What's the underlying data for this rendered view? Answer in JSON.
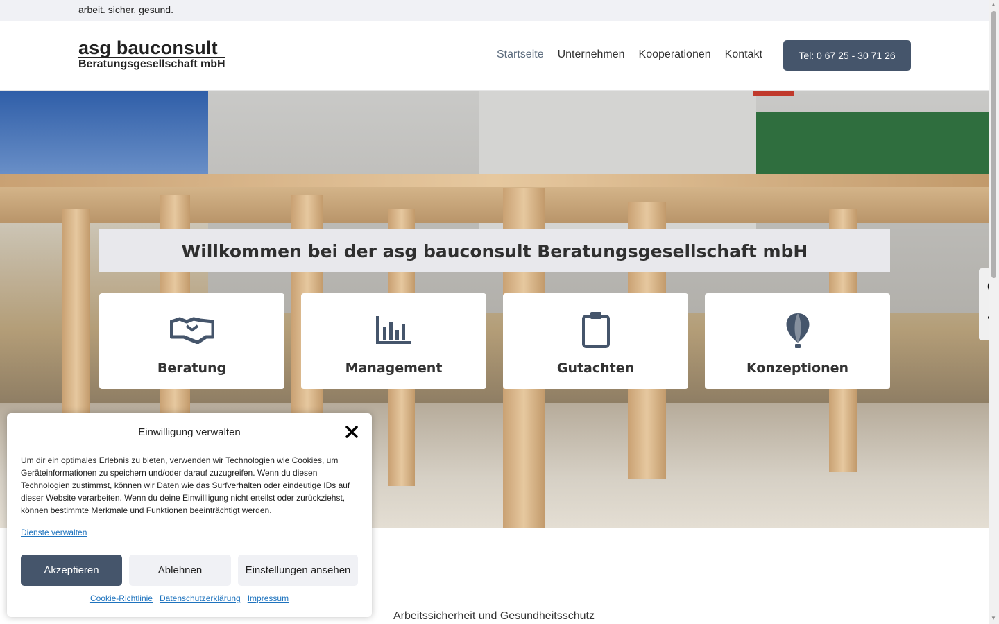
{
  "topbar": {
    "tagline": "arbeit. sicher. gesund."
  },
  "header": {
    "logo_line1": "asg bauconsult",
    "logo_line2": "Beratungsgesellschaft mbH",
    "nav": [
      {
        "label": "Startseite",
        "active": true
      },
      {
        "label": "Unternehmen"
      },
      {
        "label": "Kooperationen"
      },
      {
        "label": "Kontakt"
      }
    ],
    "call_button": "Tel: 0 67 25 - 30 71 26"
  },
  "hero": {
    "welcome": "Willkommen bei der asg bauconsult Beratungsgesellschaft mbH",
    "cards": [
      {
        "label": "Beratung",
        "icon": "handshake-icon"
      },
      {
        "label": "Management",
        "icon": "bar-chart-icon"
      },
      {
        "label": "Gutachten",
        "icon": "clipboard-icon"
      },
      {
        "label": "Konzeptionen",
        "icon": "balloon-icon"
      }
    ]
  },
  "accessibility": {
    "contrast_icon": "contrast-icon",
    "font_size_icon": "text-size-icon"
  },
  "section": {
    "subtitle": "Arbeitssicherheit und Gesundheitsschutz"
  },
  "consent": {
    "title": "Einwilligung verwalten",
    "text": "Um dir ein optimales Erlebnis zu bieten, verwenden wir Technologien wie Cookies, um Geräteinformationen zu speichern und/oder darauf zuzugreifen. Wenn du diesen Technologien zustimmst, können wir Daten wie das Surfverhalten oder eindeutige IDs auf dieser Website verarbeiten. Wenn du deine Einwillligung nicht erteilst oder zurückziehst, können bestimmte Merkmale und Funktionen beeinträchtigt werden.",
    "manage_link": "Dienste verwalten",
    "accept": "Akzeptieren",
    "deny": "Ablehnen",
    "view": "Einstellungen ansehen",
    "links": [
      "Cookie-Richtlinie",
      "Datenschutzerklärung",
      "Impressum"
    ]
  },
  "colors": {
    "accent": "#45556b",
    "link": "#1e73be"
  }
}
